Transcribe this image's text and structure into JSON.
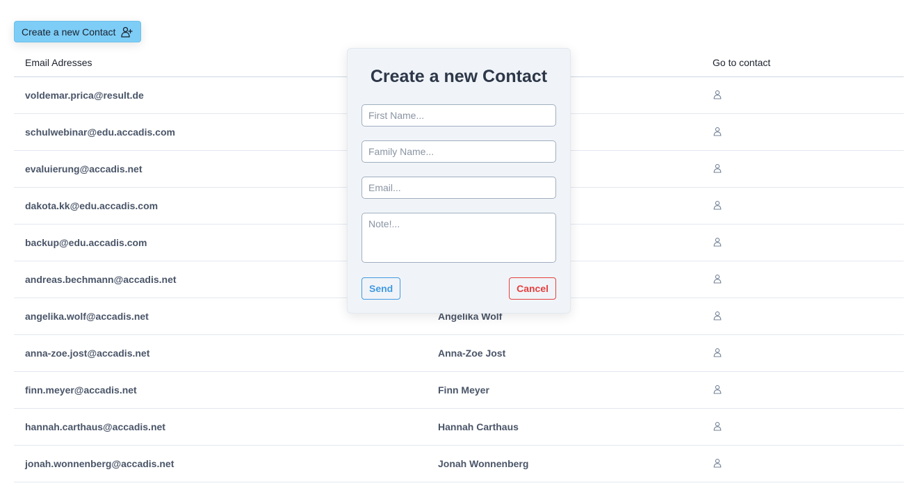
{
  "toolbar": {
    "create_label": "Create a new Contact",
    "create_icon": "user-plus-icon"
  },
  "table": {
    "headers": {
      "email": "Email Adresses",
      "name": "",
      "go": "Go to contact"
    },
    "row_icon": "user-icon",
    "rows": [
      {
        "email": "voldemar.prica@result.de",
        "name": ""
      },
      {
        "email": "schulwebinar@edu.accadis.com",
        "name": ""
      },
      {
        "email": "evaluierung@accadis.net",
        "name": ""
      },
      {
        "email": "dakota.kk@edu.accadis.com",
        "name": ""
      },
      {
        "email": "backup@edu.accadis.com",
        "name": ""
      },
      {
        "email": "andreas.bechmann@accadis.net",
        "name": ""
      },
      {
        "email": "angelika.wolf@accadis.net",
        "name": "Angelika Wolf"
      },
      {
        "email": "anna-zoe.jost@accadis.net",
        "name": "Anna-Zoe Jost"
      },
      {
        "email": "finn.meyer@accadis.net",
        "name": "Finn Meyer"
      },
      {
        "email": "hannah.carthaus@accadis.net",
        "name": "Hannah Carthaus"
      },
      {
        "email": "jonah.wonnenberg@accadis.net",
        "name": "Jonah Wonnenberg"
      }
    ]
  },
  "modal": {
    "title": "Create a new Contact",
    "first_name": {
      "value": "",
      "placeholder": "First Name..."
    },
    "family_name": {
      "value": "",
      "placeholder": "Family Name..."
    },
    "email": {
      "value": "",
      "placeholder": "Email..."
    },
    "note": {
      "value": "",
      "placeholder": "Note!..."
    },
    "send_label": "Send",
    "cancel_label": "Cancel"
  },
  "colors": {
    "create_button_bg": "#7dcdf7",
    "modal_bg": "#f0f4f8",
    "send": "#4299e1",
    "cancel": "#e53e3e"
  }
}
